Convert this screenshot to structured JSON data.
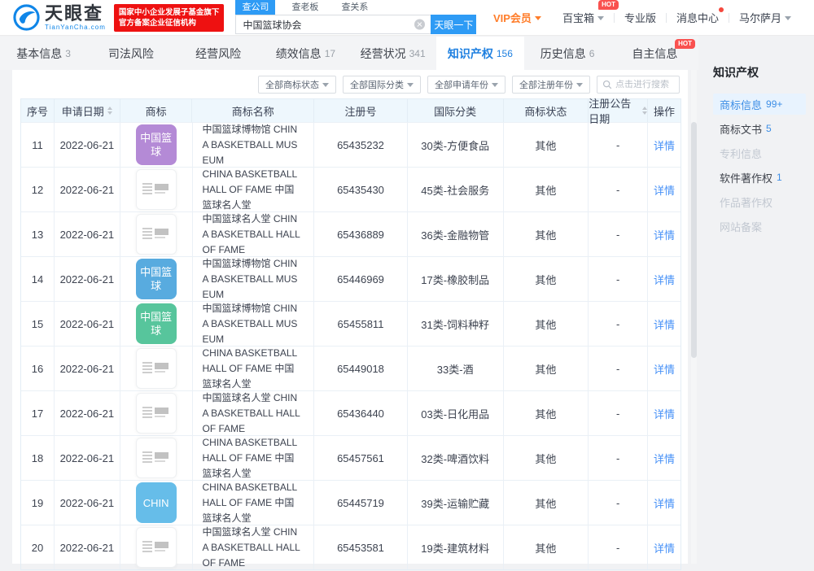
{
  "header": {
    "logo": {
      "brand": "天眼查",
      "domain": "TianYanCha.com"
    },
    "gov_badge": {
      "line1": "国家中小企业发展子基金旗下",
      "line2": "官方备案企业征信机构"
    },
    "search": {
      "tabs": [
        {
          "label": "查公司",
          "active": true
        },
        {
          "label": "查老板",
          "active": false
        },
        {
          "label": "查关系",
          "active": false
        }
      ],
      "value": "中国篮球协会",
      "button": "天眼一下"
    },
    "menu": {
      "vip": "VIP会员",
      "toolbox": "百宝箱",
      "toolbox_hot": "HOT",
      "pro": "专业版",
      "messages": "消息中心",
      "user": "马尔萨月"
    }
  },
  "tabs": [
    {
      "label": "基本信息",
      "count": "3",
      "active": false,
      "hot": ""
    },
    {
      "label": "司法风险",
      "count": "",
      "active": false,
      "hot": ""
    },
    {
      "label": "经营风险",
      "count": "",
      "active": false,
      "hot": ""
    },
    {
      "label": "绩效信息",
      "count": "17",
      "active": false,
      "hot": ""
    },
    {
      "label": "经营状况",
      "count": "341",
      "active": false,
      "hot": ""
    },
    {
      "label": "知识产权",
      "count": "156",
      "active": true,
      "hot": ""
    },
    {
      "label": "历史信息",
      "count": "6",
      "active": false,
      "hot": ""
    },
    {
      "label": "自主信息",
      "count": "",
      "active": false,
      "hot": "HOT"
    }
  ],
  "filters": {
    "dropdowns": [
      "全部商标状态",
      "全部国际分类",
      "全部申请年份",
      "全部注册年份"
    ],
    "search_placeholder": "点击进行搜索"
  },
  "table": {
    "columns": [
      "序号",
      "申请日期",
      "商标",
      "商标名称",
      "注册号",
      "国际分类",
      "商标状态",
      "注册公告日期",
      "操作"
    ],
    "rows": [
      {
        "no": "11",
        "date": "2022-06-21",
        "mark": {
          "text": "中国篮球",
          "color": "#b48ad6"
        },
        "name": "中国篮球博物馆 CHINA BASKETBALL MUSEUM",
        "reg_no": "65435232",
        "intl_class": "30类-方便食品",
        "status": "其他",
        "pub_date": "-",
        "action": "详情"
      },
      {
        "no": "12",
        "date": "2022-06-21",
        "mark": {
          "text": "",
          "color": ""
        },
        "name": "CHINA BASKETBALL HALL OF FAME 中国篮球名人堂",
        "reg_no": "65435430",
        "intl_class": "45类-社会服务",
        "status": "其他",
        "pub_date": "-",
        "action": "详情"
      },
      {
        "no": "13",
        "date": "2022-06-21",
        "mark": {
          "text": "",
          "color": ""
        },
        "name": "中国篮球名人堂 CHINA BASKETBALL HALL OF FAME",
        "reg_no": "65436889",
        "intl_class": "36类-金融物管",
        "status": "其他",
        "pub_date": "-",
        "action": "详情"
      },
      {
        "no": "14",
        "date": "2022-06-21",
        "mark": {
          "text": "中国篮球",
          "color": "#58abdf"
        },
        "name": "中国篮球博物馆 CHINA BASKETBALL MUSEUM",
        "reg_no": "65446969",
        "intl_class": "17类-橡胶制品",
        "status": "其他",
        "pub_date": "-",
        "action": "详情"
      },
      {
        "no": "15",
        "date": "2022-06-21",
        "mark": {
          "text": "中国篮球",
          "color": "#57c59c"
        },
        "name": "中国篮球博物馆 CHINA BASKETBALL MUSEUM",
        "reg_no": "65455811",
        "intl_class": "31类-饲料种籽",
        "status": "其他",
        "pub_date": "-",
        "action": "详情"
      },
      {
        "no": "16",
        "date": "2022-06-21",
        "mark": {
          "text": "",
          "color": ""
        },
        "name": "CHINA BASKETBALL HALL OF FAME 中国篮球名人堂",
        "reg_no": "65449018",
        "intl_class": "33类-酒",
        "status": "其他",
        "pub_date": "-",
        "action": "详情"
      },
      {
        "no": "17",
        "date": "2022-06-21",
        "mark": {
          "text": "",
          "color": ""
        },
        "name": "中国篮球名人堂 CHINA BASKETBALL HALL OF FAME",
        "reg_no": "65436440",
        "intl_class": "03类-日化用品",
        "status": "其他",
        "pub_date": "-",
        "action": "详情"
      },
      {
        "no": "18",
        "date": "2022-06-21",
        "mark": {
          "text": "",
          "color": ""
        },
        "name": "CHINA BASKETBALL HALL OF FAME 中国篮球名人堂",
        "reg_no": "65457561",
        "intl_class": "32类-啤酒饮料",
        "status": "其他",
        "pub_date": "-",
        "action": "详情"
      },
      {
        "no": "19",
        "date": "2022-06-21",
        "mark": {
          "text": "CHIN",
          "color": "#66bde9"
        },
        "name": "CHINA BASKETBALL HALL OF FAME 中国篮球名人堂",
        "reg_no": "65445719",
        "intl_class": "39类-运输贮藏",
        "status": "其他",
        "pub_date": "-",
        "action": "详情"
      },
      {
        "no": "20",
        "date": "2022-06-21",
        "mark": {
          "text": "",
          "color": ""
        },
        "name": "中国篮球名人堂 CHINA BASKETBALL HALL OF FAME",
        "reg_no": "65453581",
        "intl_class": "19类-建筑材料",
        "status": "其他",
        "pub_date": "-",
        "action": "详情"
      }
    ]
  },
  "sidebar": {
    "title": "知识产权",
    "items": [
      {
        "label": "商标信息",
        "count": "99+",
        "state": "active"
      },
      {
        "label": "商标文书",
        "count": "5",
        "state": "normal"
      },
      {
        "label": "专利信息",
        "count": "",
        "state": "disabled"
      },
      {
        "label": "软件著作权",
        "count": "1",
        "state": "normal"
      },
      {
        "label": "作品著作权",
        "count": "",
        "state": "disabled"
      },
      {
        "label": "网站备案",
        "count": "",
        "state": "disabled"
      }
    ]
  },
  "icons": {
    "logo": "eagle-eye-icon",
    "search": "magnifier-icon",
    "clear": "clear-circle-icon",
    "dropdown": "chevron-down-icon",
    "sort": "sort-arrows-icon",
    "notification": "red-dot-icon"
  },
  "colors": {
    "accent_blue": "#2e9bf5",
    "link_blue": "#4590f7",
    "active_tab_blue": "#1f80e0",
    "vip_orange": "#ff7d2a",
    "hot_red": "#f9514f",
    "gov_badge_red": "#ee1111",
    "table_header_bg": "#eef7fd",
    "sidebar_active_bg": "#e8f3fe"
  }
}
